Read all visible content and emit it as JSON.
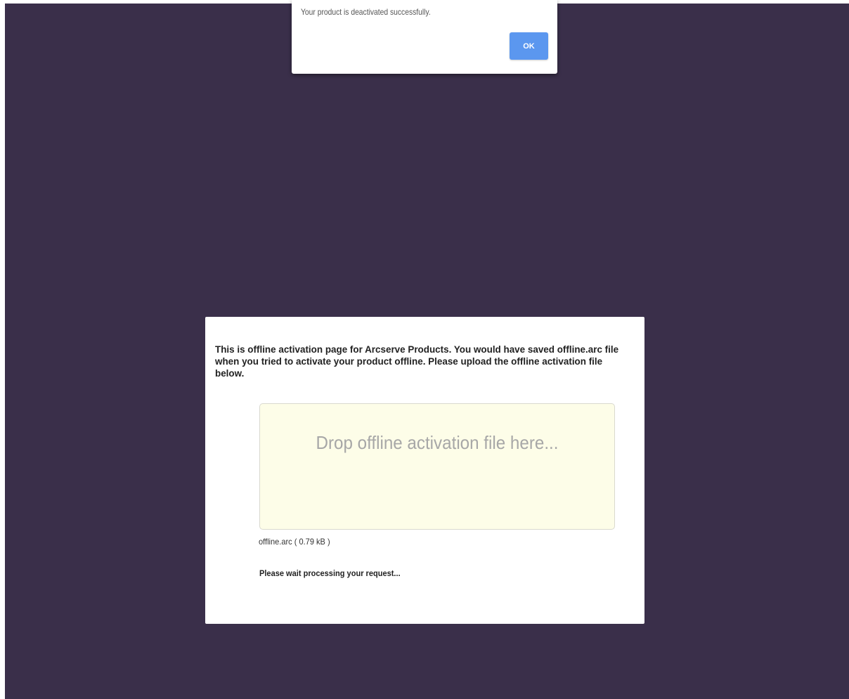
{
  "alert": {
    "message": "Your product is deactivated successfully.",
    "ok_label": "OK"
  },
  "activation": {
    "intro": "This is offline activation page for Arcserve Products. You would have saved offline.arc file when you tried to activate your product offline. Please upload the offline activation file below.",
    "drop_zone_text": "Drop offline activation file here...",
    "file_info": "offline.arc ( 0.79 kB )",
    "status": "Please wait processing your request..."
  },
  "colors": {
    "backdrop": "#3a2f4a",
    "ok_button": "#5b97ef",
    "drop_zone": "#fdfde8"
  }
}
